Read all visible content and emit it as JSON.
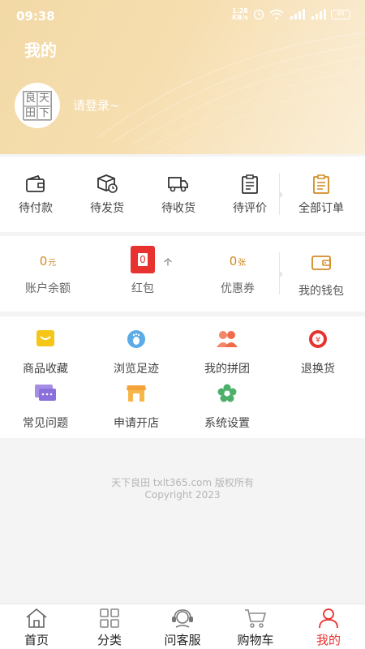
{
  "status": {
    "time": "09:38",
    "net_speed_top": "1.28",
    "net_speed_bottom": "KB/s",
    "battery": "88"
  },
  "header": {
    "title": "我的",
    "login_prompt": "请登录~",
    "avatar_logo": [
      "良",
      "天",
      "田",
      "下"
    ]
  },
  "orders": [
    {
      "label": "待付款",
      "icon": "wallet-icon"
    },
    {
      "label": "待发货",
      "icon": "package-clock-icon"
    },
    {
      "label": "待收货",
      "icon": "truck-icon"
    },
    {
      "label": "待评价",
      "icon": "clipboard-icon"
    },
    {
      "label": "全部订单",
      "icon": "orders-list-icon"
    }
  ],
  "wallet": {
    "balance": {
      "value": "0",
      "unit": "元",
      "label": "账户余额"
    },
    "red_packet": {
      "value": "0",
      "unit": "个",
      "label": "红包"
    },
    "coupons": {
      "value": "0",
      "unit": "张",
      "label": "优惠券"
    },
    "my_wallet": {
      "label": "我的钱包"
    }
  },
  "services": [
    {
      "label": "商品收藏",
      "icon": "favorites-icon"
    },
    {
      "label": "浏览足迹",
      "icon": "footprint-icon"
    },
    {
      "label": "我的拼团",
      "icon": "group-buy-icon"
    },
    {
      "label": "退换货",
      "icon": "refund-icon"
    },
    {
      "label": "常见问题",
      "icon": "faq-chat-icon"
    },
    {
      "label": "申请开店",
      "icon": "store-icon"
    },
    {
      "label": "系统设置",
      "icon": "settings-flower-icon"
    }
  ],
  "footer": {
    "line1": "天下良田 txlt365.com 版权所有",
    "line2": "Copyright 2023"
  },
  "tabbar": [
    {
      "label": "首页",
      "icon": "home-icon"
    },
    {
      "label": "分类",
      "icon": "category-grid-icon"
    },
    {
      "label": "问客服",
      "icon": "customer-service-icon"
    },
    {
      "label": "购物车",
      "icon": "cart-icon"
    },
    {
      "label": "我的",
      "icon": "user-icon",
      "active": true
    }
  ],
  "colors": {
    "accent": "#e8322f",
    "gold": "#d28a22",
    "header_gradient_start": "#f2d9a6",
    "header_gradient_end": "#fbefd9"
  }
}
